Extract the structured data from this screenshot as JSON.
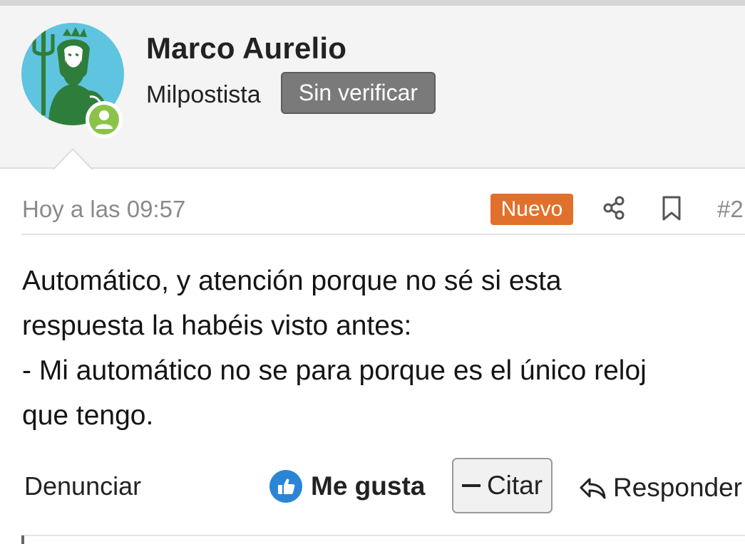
{
  "user": {
    "name": "Marco Aurelio",
    "title": "Milpostista",
    "badge": "Sin verificar",
    "avatar_icon": "neptune-avatar",
    "status_icon": "user-status-icon",
    "status_color": "#8bc34a"
  },
  "post": {
    "date": "Hoy a las 09:57",
    "new_label": "Nuevo",
    "new_color": "#e1702c",
    "number": "#2",
    "share_icon": "share-icon",
    "bookmark_icon": "bookmark-icon",
    "body": "Automático, y atención porque no sé si esta\nrespuesta la habéis visto antes:\n- Mi automático no se para porque es el único reloj\nque tengo."
  },
  "actions": {
    "report": "Denunciar",
    "like": "Me gusta",
    "like_icon": "thumbs-up-icon",
    "quote": "Citar",
    "reply": "Responder",
    "reply_icon": "reply-icon"
  }
}
